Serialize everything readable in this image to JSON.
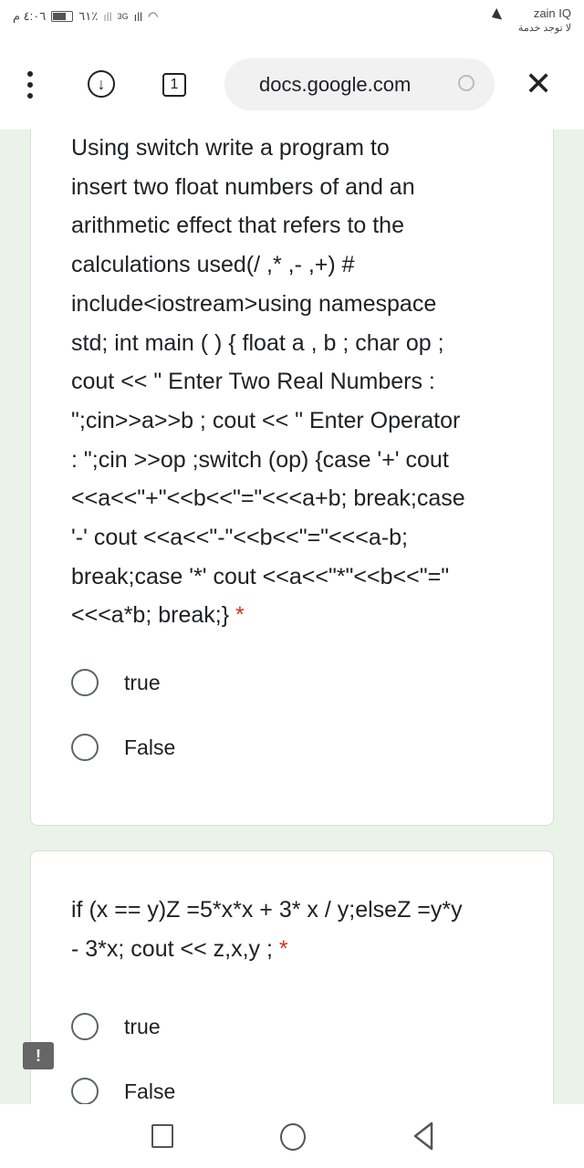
{
  "status_bar": {
    "time": "٤:٠٦ م",
    "battery": "٦١٪",
    "battery_level": 0.61,
    "network": "3G",
    "carrier": "zain IQ",
    "service": "لا توجد خدمة"
  },
  "toolbar": {
    "tab_count": "1",
    "url": "docs.google.com"
  },
  "questions": [
    {
      "lines": [
        "Using switch write a program to",
        "insert two float numbers of and an",
        "arithmetic effect that refers to the",
        "calculations used(/ ,* ,- ,+) #",
        "include<iostream>using namespace",
        "std; int main ( ) { float a , b ; char op ;",
        "cout << \" Enter Two Real Numbers :",
        "\";cin>>a>>b ; cout << \" Enter Operator",
        ": \";cin >>op ;switch (op) {case '+' cout",
        "<<a<<\"+\"<<b<<\"=\"<<<a+b; break;case",
        "'-' cout <<a<<\"-\"<<b<<\"=\"<<<a-b;",
        "break;case '*' cout <<a<<\"*\"<<b<<\"=\"",
        "<<<a*b; break;}"
      ],
      "required_mark": "*",
      "options": [
        "true",
        "False"
      ]
    },
    {
      "lines": [
        "if (x == y)Z =5*x*x + 3* x / y;elseZ =y*y",
        "- 3*x; cout << z,x,y ;"
      ],
      "required_mark": "*",
      "options": [
        "true",
        "False"
      ]
    }
  ],
  "colors": {
    "page_bg": "#e9f3e7",
    "required": "#d93025"
  }
}
